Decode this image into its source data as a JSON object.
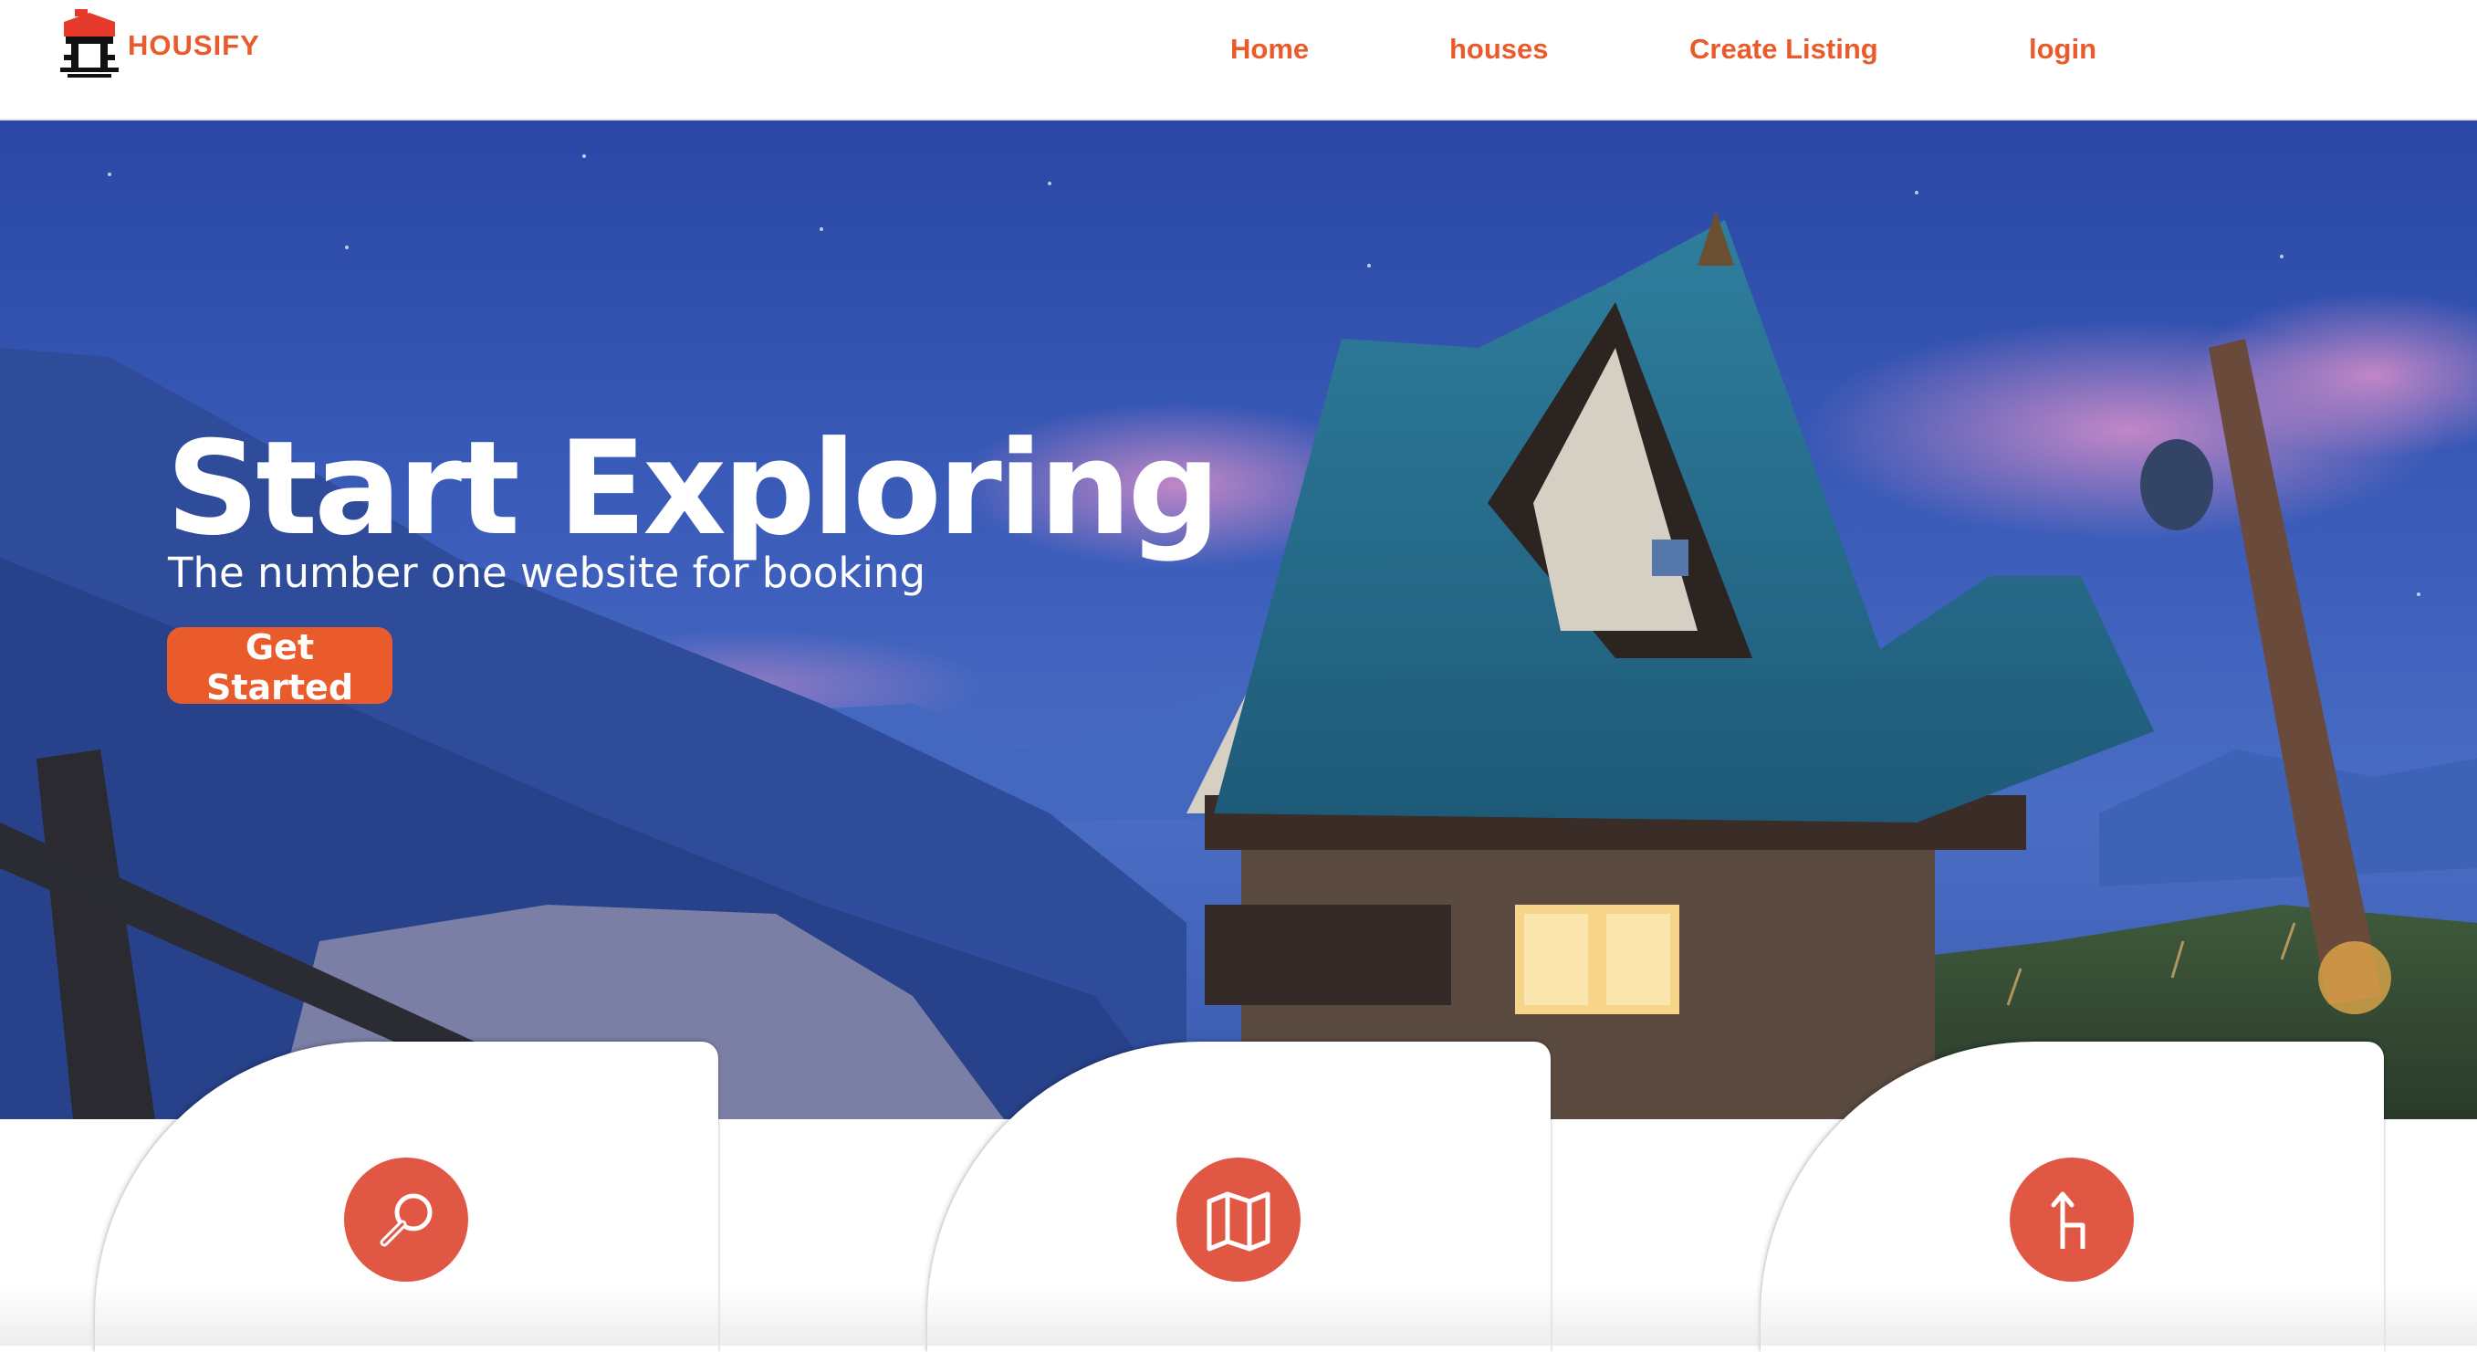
{
  "brand": {
    "name": "HOUSIFY",
    "icon": "house-logo-icon",
    "color": "#ea5b2b"
  },
  "nav": {
    "links": [
      {
        "label": "Home"
      },
      {
        "label": "houses"
      },
      {
        "label": "Create Listing"
      },
      {
        "label": "login"
      }
    ]
  },
  "hero": {
    "title": "Start Exploring",
    "subtitle": "The number one website for booking",
    "cta_label": "Get Started",
    "accent": "#ea5b2b"
  },
  "features": [
    {
      "icon": "search-icon",
      "color": "#e05744"
    },
    {
      "icon": "map-icon",
      "color": "#e05744"
    },
    {
      "icon": "route-icon",
      "color": "#e05744"
    }
  ]
}
